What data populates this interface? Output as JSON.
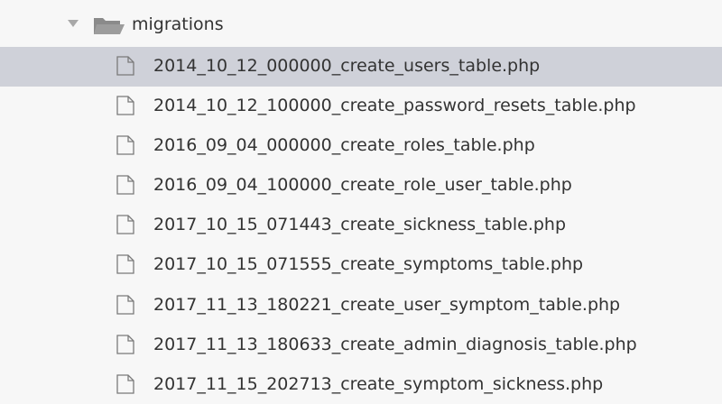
{
  "tree": {
    "folder": {
      "name": "migrations",
      "expanded": true,
      "icon": "folder-open-icon"
    },
    "selected_index": 0,
    "files": [
      {
        "name": "2014_10_12_000000_create_users_table.php",
        "icon": "file-icon"
      },
      {
        "name": "2014_10_12_100000_create_password_resets_table.php",
        "icon": "file-icon"
      },
      {
        "name": "2016_09_04_000000_create_roles_table.php",
        "icon": "file-icon"
      },
      {
        "name": "2016_09_04_100000_create_role_user_table.php",
        "icon": "file-icon"
      },
      {
        "name": "2017_10_15_071443_create_sickness_table.php",
        "icon": "file-icon"
      },
      {
        "name": "2017_10_15_071555_create_symptoms_table.php",
        "icon": "file-icon"
      },
      {
        "name": "2017_11_13_180221_create_user_symptom_table.php",
        "icon": "file-icon"
      },
      {
        "name": "2017_11_13_180633_create_admin_diagnosis_table.php",
        "icon": "file-icon"
      },
      {
        "name": "2017_11_15_202713_create_symptom_sickness.php",
        "icon": "file-icon"
      }
    ]
  },
  "colors": {
    "background": "#f7f7f7",
    "selection": "#cfd1d9",
    "text": "#333333",
    "icon": "#7a7a7a"
  }
}
